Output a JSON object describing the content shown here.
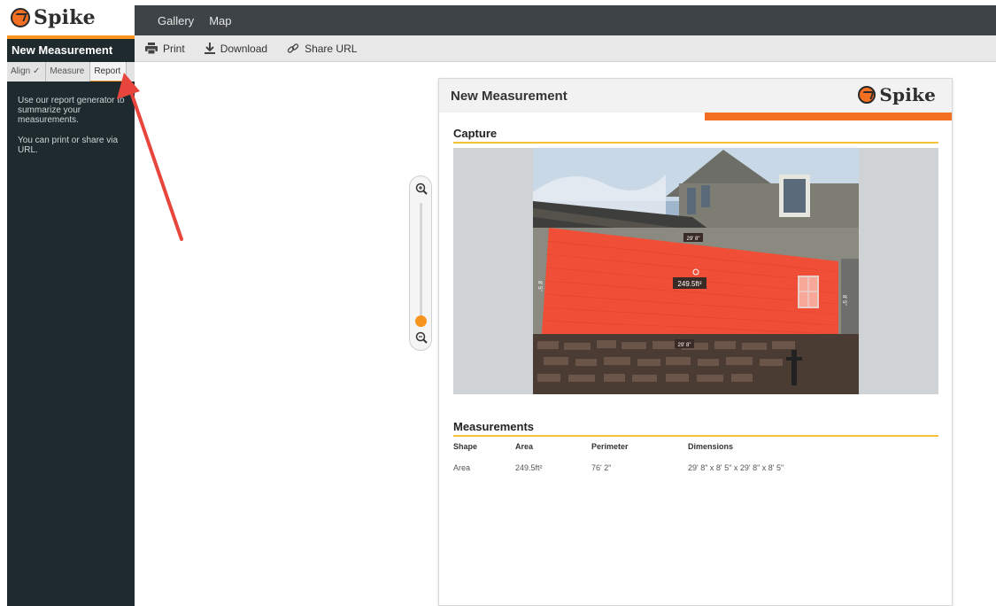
{
  "app": {
    "name": "Spike"
  },
  "sidebar": {
    "title": "New Measurement",
    "steps": [
      {
        "label": "Align ✓"
      },
      {
        "label": "Measure"
      },
      {
        "label": "Report"
      }
    ],
    "help": [
      "Use our report generator to summarize your measurements.",
      "You can print or share via URL."
    ]
  },
  "nav": {
    "items": [
      "Gallery",
      "Map"
    ]
  },
  "toolbar": {
    "print": "Print",
    "download": "Download",
    "share": "Share URL"
  },
  "report": {
    "title": "New Measurement",
    "logo": "Spike",
    "capture_title": "Capture",
    "photo_labels": {
      "top": "29' 8\"",
      "bottom": "29' 8\"",
      "left": "8' 5\"",
      "right": "8' 5\"",
      "area": "249.5ft²"
    },
    "measurements_title": "Measurements",
    "columns": [
      "Shape",
      "Area",
      "Perimeter",
      "Dimensions"
    ],
    "rows": [
      {
        "shape": "Area",
        "area": "249.5ft²",
        "perimeter": "76' 2\"",
        "dimensions": "29' 8\" x 8' 5\" x 29' 8\" x 8' 5\""
      }
    ]
  },
  "colors": {
    "accent": "#f7941d",
    "sidebar": "#1e2a2e",
    "nav": "#3d4346",
    "overlay": "#f04e37"
  }
}
